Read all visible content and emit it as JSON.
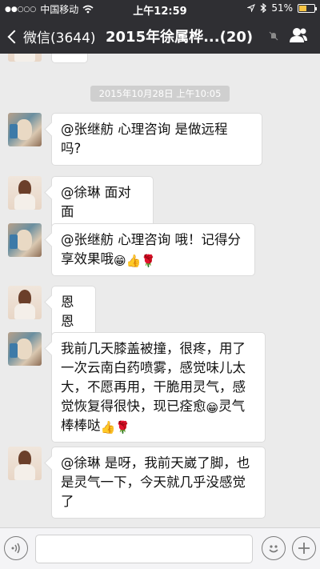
{
  "status_bar": {
    "carrier": "中国移动",
    "time": "上午12:59",
    "battery": "51%",
    "battery_level": 0.51,
    "icons": [
      "signal-dots-icon",
      "wifi-icon",
      "location-icon",
      "bluetooth-icon",
      "battery-icon"
    ]
  },
  "nav": {
    "back_label": "微信(3644)",
    "title": "2015年徐属桦...(20)",
    "icons": [
      "back-chevron-icon",
      "mute-icon",
      "group-members-icon"
    ]
  },
  "chat": {
    "timestamp": "2015年10月28日 上午10:05",
    "messages": [
      {
        "avatar": "avatar-a",
        "text": "@张继舫 心理咨询 是做远程\n吗?"
      },
      {
        "avatar": "avatar-b",
        "text": "@徐琳 面对面"
      },
      {
        "avatar": "avatar-a",
        "text": "@张继舫 心理咨询 哦！记得分\n享效果哦",
        "emoji": [
          "grin-icon",
          "thumbs-up-icon",
          "rose-icon"
        ]
      },
      {
        "avatar": "avatar-b",
        "text": "恩恩"
      },
      {
        "avatar": "avatar-a",
        "text": "我前几天膝盖被撞，很疼，用了\n一次云南白药喷雾，感觉味儿太\n大，不愿再用，干脆用灵气，感\n觉恢复得很快，现已痊愈",
        "text_tail": "灵气\n棒棒哒",
        "emoji": [
          "grin-icon",
          "thumbs-up-icon",
          "rose-icon"
        ]
      },
      {
        "avatar": "avatar-b",
        "text": "@徐琳 是呀，我前天崴了脚，也\n是灵气一下，今天就几乎没感觉\n了"
      }
    ]
  },
  "input_bar": {
    "icons": [
      "voice-icon",
      "emoji-icon",
      "plus-icon"
    ],
    "placeholder": ""
  }
}
